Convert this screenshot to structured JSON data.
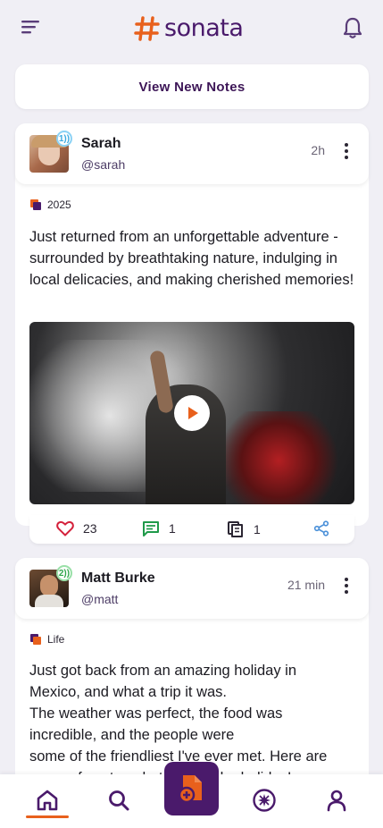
{
  "app": {
    "logo_text": "sonata",
    "brand_color": "#4a1a6b",
    "accent_color": "#e8601c"
  },
  "header": {
    "menu_icon": "hamburger-menu-icon",
    "notification_icon": "bell-icon"
  },
  "feed": {
    "view_new_label": "View New Notes"
  },
  "posts": [
    {
      "name": "Sarah",
      "handle": "@sarah",
      "time": "2h",
      "badge": "1))",
      "tag": "2025",
      "text": "Just returned from an unforgettable adventure - surrounded by breathtaking nature, indulging in local delicacies, and making cherished memories!",
      "media": "video",
      "likes": "23",
      "comments": "1",
      "reposts": "1"
    },
    {
      "name": "Matt Burke",
      "handle": "@matt",
      "time": "21 min",
      "badge": "2))",
      "tag": "Life",
      "text_lines": [
        "Just got back from an amazing holiday in",
        "Mexico, and what a trip it was.",
        "The weather was perfect, the food was",
        "incredible, and the people were",
        "some of the friendliest I've ever met. Here are",
        "some of my top photos from the holiday!"
      ]
    }
  ],
  "bottom_nav": {
    "items": [
      "home",
      "search",
      "create",
      "explore",
      "profile"
    ],
    "active": "home"
  }
}
